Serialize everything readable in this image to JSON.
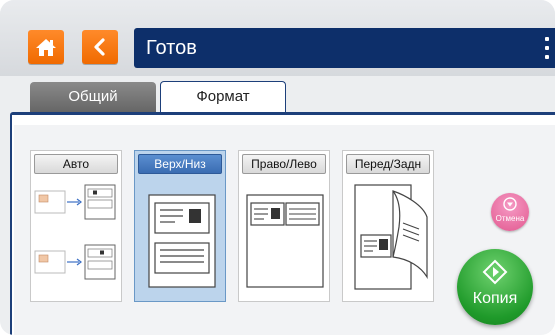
{
  "header": {
    "home_icon": "home-icon",
    "back_icon": "chevron-left-icon",
    "title": "Готов",
    "menu_icon": "kebab-menu-icon",
    "accent_color": "#f57a14",
    "title_bar_color": "#0d2f6a"
  },
  "tabs": [
    {
      "label": "Общий",
      "active": false
    },
    {
      "label": "Формат",
      "active": true
    }
  ],
  "options": [
    {
      "label": "Авто",
      "selected": false
    },
    {
      "label": "Верх/Низ",
      "selected": true
    },
    {
      "label": "Право/Лево",
      "selected": false
    },
    {
      "label": "Перед/Задн",
      "selected": false
    }
  ],
  "actions": {
    "cancel_label": "Отмена",
    "cancel_color": "#e2588f",
    "copy_label": "Копия",
    "copy_color": "#1f9a2a"
  }
}
